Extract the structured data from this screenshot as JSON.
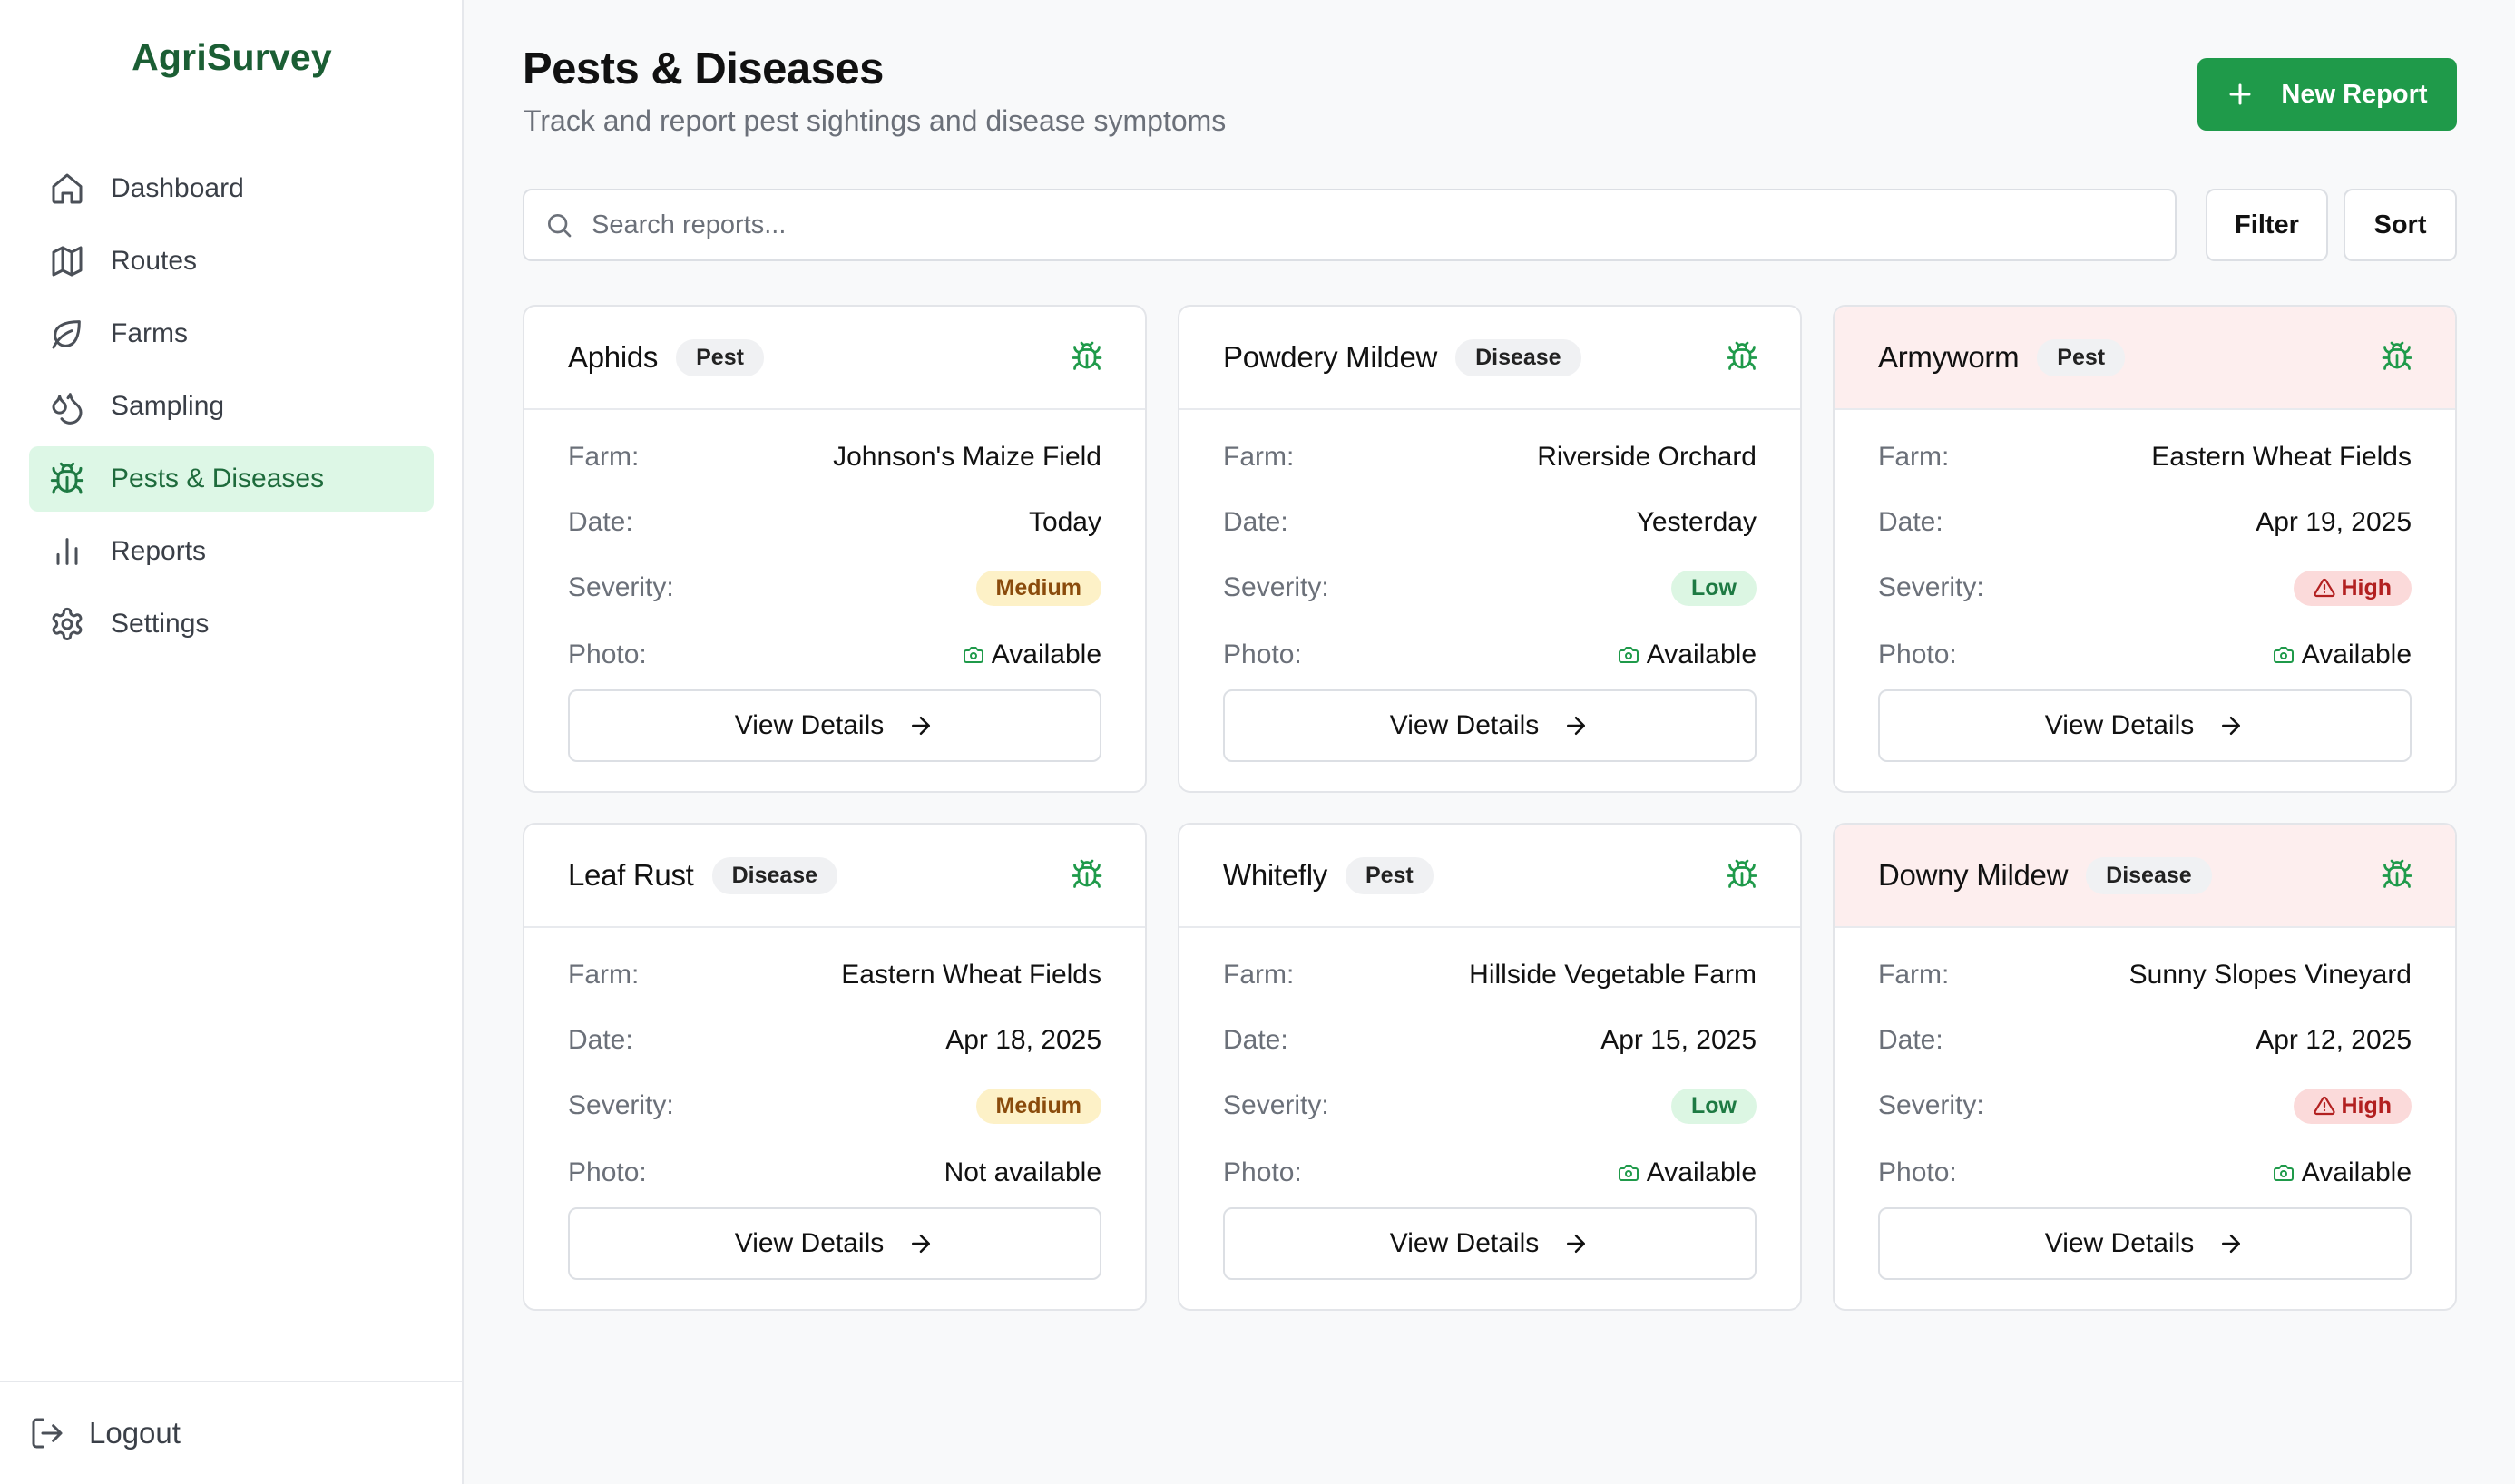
{
  "app": {
    "brand": "AgriSurvey"
  },
  "sidebar": {
    "items": [
      {
        "label": "Dashboard",
        "icon": "home-icon"
      },
      {
        "label": "Routes",
        "icon": "map-icon"
      },
      {
        "label": "Farms",
        "icon": "leaf-icon"
      },
      {
        "label": "Sampling",
        "icon": "droplets-icon"
      },
      {
        "label": "Pests & Diseases",
        "icon": "bug-icon",
        "active": true
      },
      {
        "label": "Reports",
        "icon": "bar-chart-icon"
      },
      {
        "label": "Settings",
        "icon": "gear-icon"
      }
    ],
    "logout_label": "Logout"
  },
  "header": {
    "title": "Pests & Diseases",
    "subtitle": "Track and report pest sightings and disease symptoms",
    "new_report_label": "New Report"
  },
  "toolbar": {
    "search_placeholder": "Search reports...",
    "filter_label": "Filter",
    "sort_label": "Sort"
  },
  "labels": {
    "farm": "Farm:",
    "date": "Date:",
    "severity": "Severity:",
    "photo": "Photo:",
    "view_details": "View Details"
  },
  "colors": {
    "accent": "#1f9a4a",
    "brand": "#1b5e34",
    "active_nav_bg": "#ddf7e6",
    "high_header_bg": "#fdeeee"
  },
  "reports": [
    {
      "name": "Aphids",
      "type": "Pest",
      "farm": "Johnson's Maize Field",
      "date": "Today",
      "severity": "Medium",
      "photo": "Available"
    },
    {
      "name": "Powdery Mildew",
      "type": "Disease",
      "farm": "Riverside Orchard",
      "date": "Yesterday",
      "severity": "Low",
      "photo": "Available"
    },
    {
      "name": "Armyworm",
      "type": "Pest",
      "farm": "Eastern Wheat Fields",
      "date": "Apr 19, 2025",
      "severity": "High",
      "photo": "Available"
    },
    {
      "name": "Leaf Rust",
      "type": "Disease",
      "farm": "Eastern Wheat Fields",
      "date": "Apr 18, 2025",
      "severity": "Medium",
      "photo": "Not available"
    },
    {
      "name": "Whitefly",
      "type": "Pest",
      "farm": "Hillside Vegetable Farm",
      "date": "Apr 15, 2025",
      "severity": "Low",
      "photo": "Available"
    },
    {
      "name": "Downy Mildew",
      "type": "Disease",
      "farm": "Sunny Slopes Vineyard",
      "date": "Apr 12, 2025",
      "severity": "High",
      "photo": "Available"
    }
  ]
}
